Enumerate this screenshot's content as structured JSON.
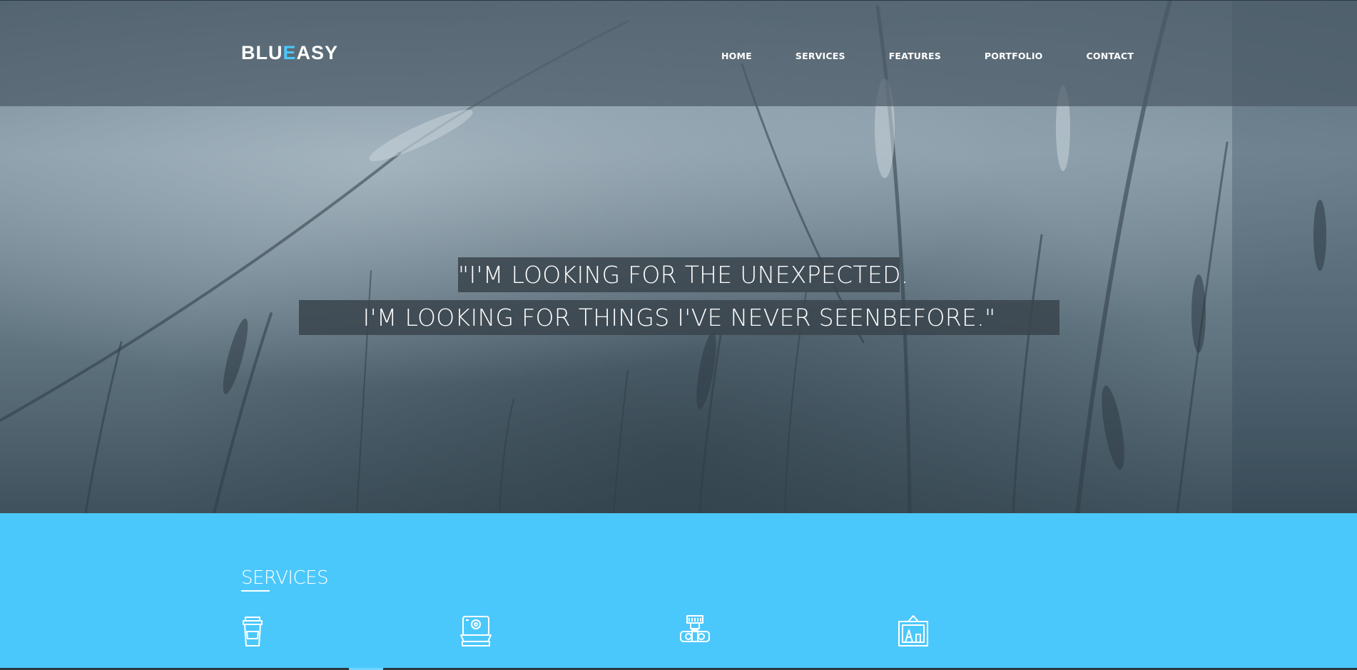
{
  "brand": {
    "prefix": "BLU",
    "accent": "E",
    "suffix": "ASY",
    "accent_color": "#4bc8fb"
  },
  "nav": [
    {
      "label": "HOME"
    },
    {
      "label": "SERVICES"
    },
    {
      "label": "FEATURES"
    },
    {
      "label": "PORTFOLIO"
    },
    {
      "label": "CONTACT"
    }
  ],
  "hero": {
    "quote_line1": "\"I'M LOOKING FOR THE UNEXPECTED.",
    "quote_line2": "I'M LOOKING FOR THINGS I'VE NEVER SEENBEFORE.\""
  },
  "services": {
    "title": "SERVICES",
    "icons": [
      "coffee-cup-icon",
      "polaroid-camera-icon",
      "camera-icon",
      "picture-frame-icon"
    ]
  },
  "colors": {
    "section_bg": "#4bc8fb",
    "header_overlay": "#4b5a66"
  }
}
